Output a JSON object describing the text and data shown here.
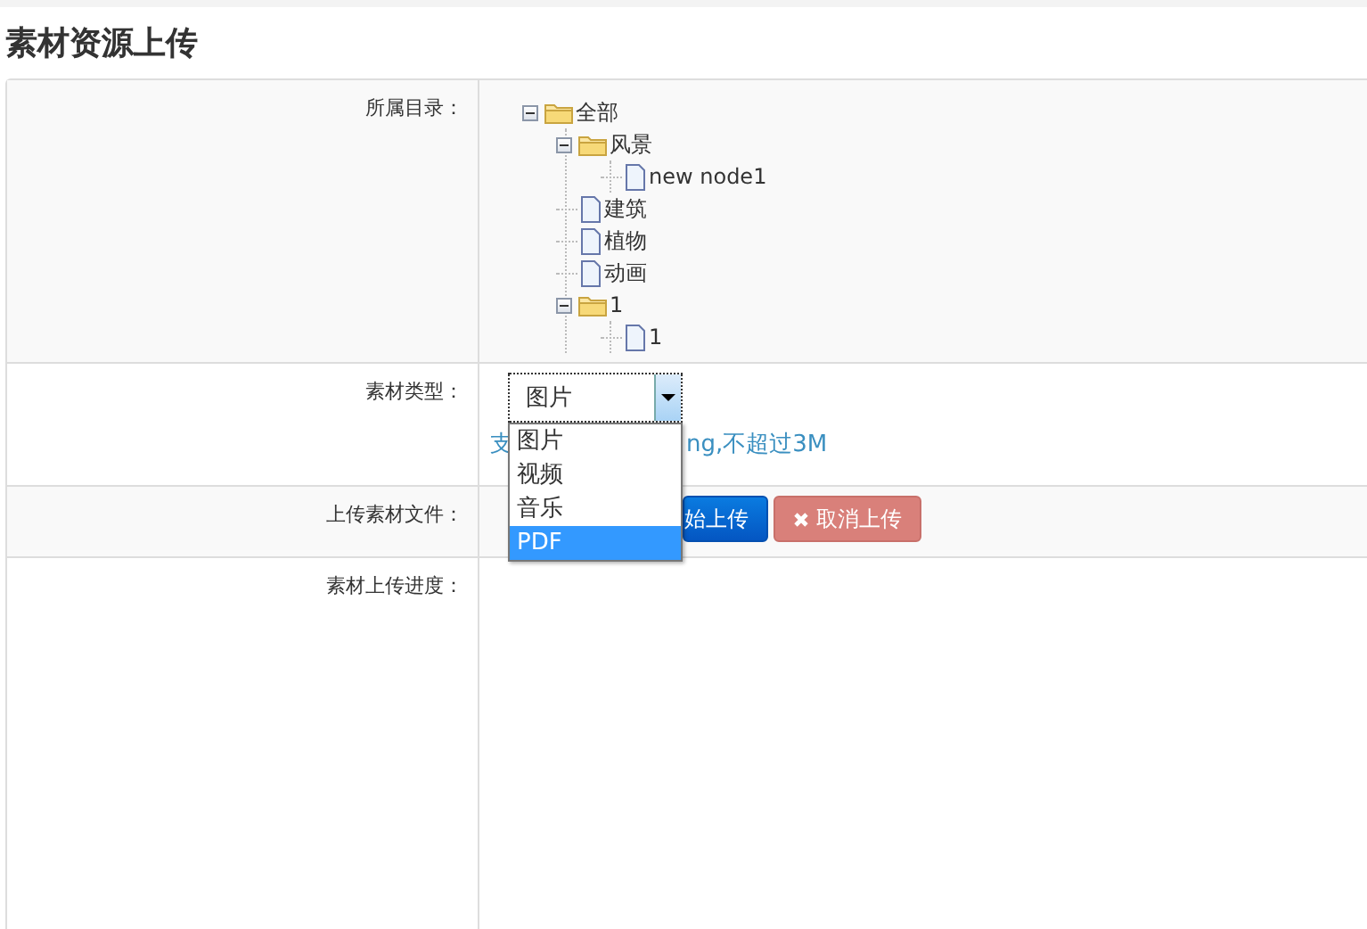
{
  "title": "素材资源上传",
  "form": {
    "rows": [
      {
        "kind": "tree",
        "label": "所属目录：",
        "tree": [
          {
            "label": "全部",
            "kind": "folder",
            "expanded": true,
            "children": [
              {
                "label": "风景",
                "kind": "folder",
                "expanded": true,
                "children": [
                  {
                    "label": "new node1",
                    "kind": "file"
                  }
                ]
              },
              {
                "label": "建筑",
                "kind": "file"
              },
              {
                "label": "植物",
                "kind": "file"
              },
              {
                "label": "动画",
                "kind": "file"
              },
              {
                "label": "1",
                "kind": "folder",
                "expanded": true,
                "children": [
                  {
                    "label": "1",
                    "kind": "file"
                  }
                ]
              }
            ]
          }
        ]
      },
      {
        "kind": "select",
        "label": "素材类型：",
        "value": "图片",
        "hint_parts": [
          "支",
          "ng,不超过3M"
        ],
        "options": [
          {
            "label": "图片",
            "highlighted": false
          },
          {
            "label": "视频",
            "highlighted": false
          },
          {
            "label": "音乐",
            "highlighted": false
          },
          {
            "label": "PDF",
            "highlighted": true
          }
        ]
      },
      {
        "kind": "buttons",
        "label": "上传素材文件：",
        "buttons": [
          {
            "label": "始上传",
            "kind": "primary"
          },
          {
            "label": "取消上传",
            "kind": "danger"
          }
        ]
      },
      {
        "kind": "empty",
        "label": "素材上传进度："
      }
    ]
  }
}
